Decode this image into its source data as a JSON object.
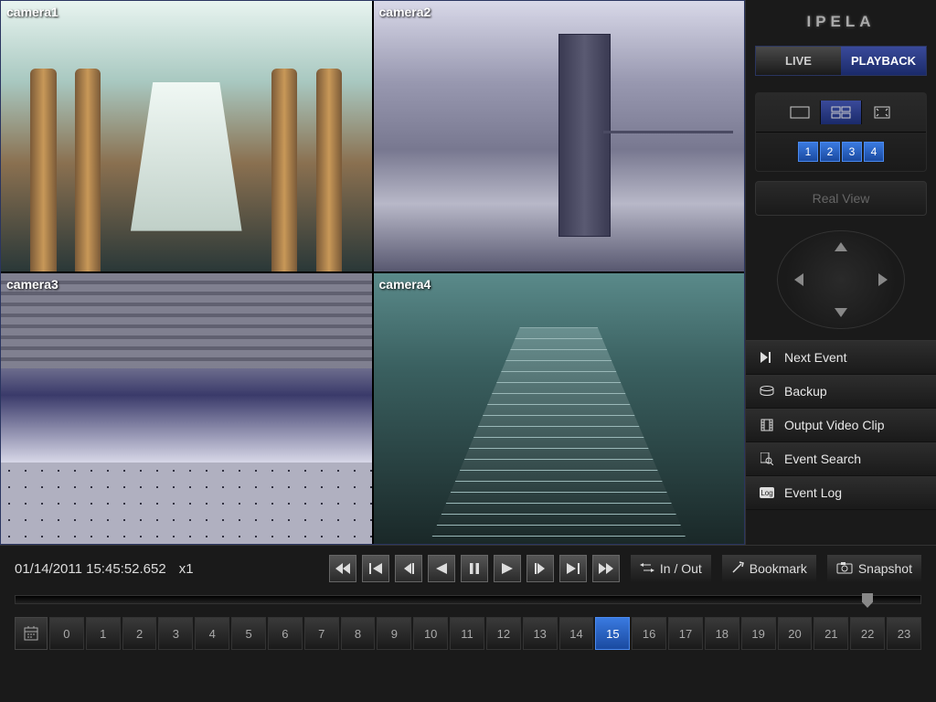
{
  "brand": "IPELA",
  "mode": {
    "live": "LIVE",
    "playback": "PLAYBACK",
    "active": "playback"
  },
  "cameras": [
    "camera1",
    "camera2",
    "camera3",
    "camera4"
  ],
  "layout_numbers": [
    "1",
    "2",
    "3",
    "4"
  ],
  "realview_label": "Real View",
  "actions": {
    "next_event": "Next Event",
    "backup": "Backup",
    "output_clip": "Output Video Clip",
    "event_search": "Event Search",
    "event_log": "Event Log"
  },
  "playback": {
    "timestamp": "01/14/2011 15:45:52.652",
    "speed": "x1",
    "inout_label": "In / Out",
    "bookmark_label": "Bookmark",
    "snapshot_label": "Snapshot"
  },
  "hours": [
    "0",
    "1",
    "2",
    "3",
    "4",
    "5",
    "6",
    "7",
    "8",
    "9",
    "10",
    "11",
    "12",
    "13",
    "14",
    "15",
    "16",
    "17",
    "18",
    "19",
    "20",
    "21",
    "22",
    "23"
  ],
  "active_hour": "15"
}
